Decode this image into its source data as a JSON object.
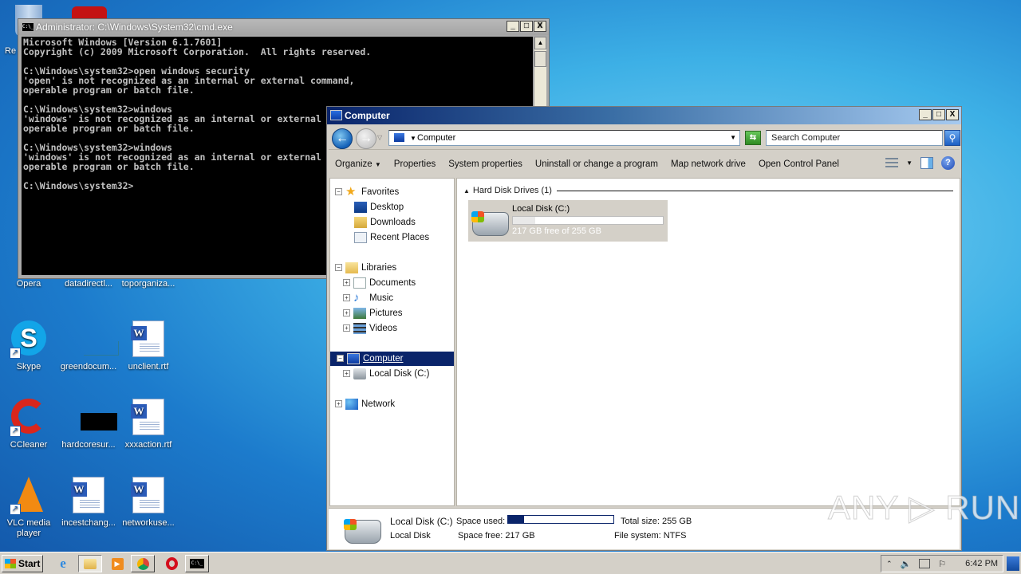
{
  "desktop": {
    "icons": [
      {
        "label": "Re",
        "type": "recycle-bin"
      },
      {
        "label": "Opera",
        "type": "opera"
      },
      {
        "label": "datadirectl...",
        "type": "file"
      },
      {
        "label": "toporganiza...",
        "type": "file"
      },
      {
        "label": "Skype",
        "type": "skype"
      },
      {
        "label": "greendocum...",
        "type": "file"
      },
      {
        "label": "unclient.rtf",
        "type": "word"
      },
      {
        "label": "CCleaner",
        "type": "ccleaner"
      },
      {
        "label": "hardcoresur...",
        "type": "black-file"
      },
      {
        "label": "xxxaction.rtf",
        "type": "word"
      },
      {
        "label": "VLC media player",
        "type": "vlc"
      },
      {
        "label": "incestchang...",
        "type": "word"
      },
      {
        "label": "networkuse...",
        "type": "word"
      }
    ]
  },
  "cmd": {
    "title": "Administrator: C:\\Windows\\System32\\cmd.exe",
    "icon_text": "C:\\_",
    "lines": [
      "Microsoft Windows [Version 6.1.7601]",
      "Copyright (c) 2009 Microsoft Corporation.  All rights reserved.",
      "",
      "C:\\Windows\\system32>open windows security",
      "'open' is not recognized as an internal or external command,",
      "operable program or batch file.",
      "",
      "C:\\Windows\\system32>windows",
      "'windows' is not recognized as an internal or external command,",
      "operable program or batch file.",
      "",
      "C:\\Windows\\system32>windows",
      "'windows' is not recognized as an internal or external command,",
      "operable program or batch file.",
      "",
      "C:\\Windows\\system32>"
    ]
  },
  "window_buttons": {
    "minimize": "_",
    "maximize": "□",
    "close": "X"
  },
  "explorer": {
    "title": "Computer",
    "address": {
      "path": "Computer",
      "separator": "▸"
    },
    "search": {
      "placeholder": "Search Computer"
    },
    "toolbar": {
      "organize": "Organize",
      "properties": "Properties",
      "system_properties": "System properties",
      "uninstall": "Uninstall or change a program",
      "map_drive": "Map network drive",
      "control_panel": "Open Control Panel"
    },
    "nav": {
      "favorites": "Favorites",
      "desktop": "Desktop",
      "downloads": "Downloads",
      "recent": "Recent Places",
      "libraries": "Libraries",
      "documents": "Documents",
      "music": "Music",
      "pictures": "Pictures",
      "videos": "Videos",
      "computer": "Computer",
      "local_disk": "Local Disk (C:)",
      "network": "Network"
    },
    "content": {
      "group_header": "Hard Disk Drives (1)",
      "drive": {
        "name": "Local Disk (C:)",
        "free_text": "217 GB free of 255 GB",
        "used_fraction": 0.15
      }
    },
    "details": {
      "name": "Local Disk (C:)",
      "type": "Local Disk",
      "space_used_label": "Space used:",
      "space_used_fraction": 0.15,
      "space_free": "Space free: 217 GB",
      "total_size": "Total size: 255 GB",
      "file_system": "File system: NTFS"
    }
  },
  "watermark": "ANY ▷ RUN",
  "taskbar": {
    "start": "Start",
    "apps": [
      "internet-explorer",
      "windows-explorer",
      "media-player",
      "chrome",
      "opera",
      "cmd"
    ],
    "clock": "6:42 PM"
  }
}
